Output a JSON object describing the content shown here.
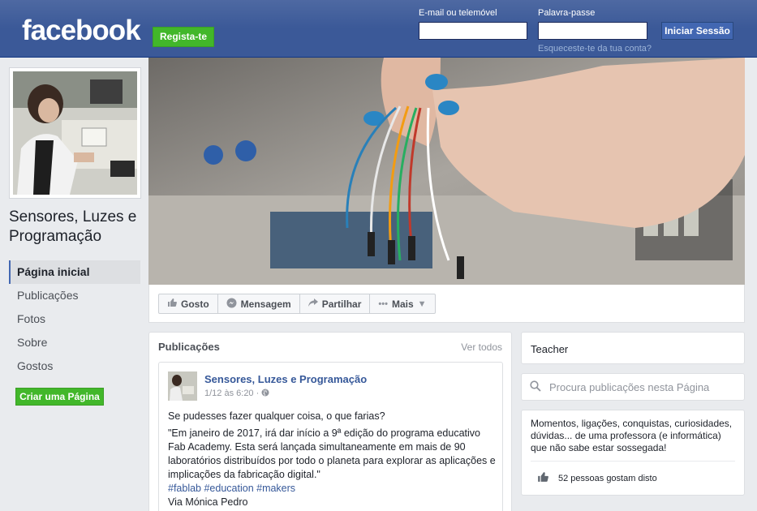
{
  "header": {
    "logo": "facebook",
    "signup_label": "Regista-te",
    "email_label": "E-mail ou telemóvel",
    "email_value": "",
    "password_label": "Palavra-passe",
    "password_value": "",
    "login_label": "Iniciar Sessão",
    "forgot_label": "Esqueceste-te da tua conta?"
  },
  "sidebar": {
    "page_name": "Sensores, Luzes e Programação",
    "items": [
      {
        "label": "Página inicial",
        "active": true
      },
      {
        "label": "Publicações",
        "active": false
      },
      {
        "label": "Fotos",
        "active": false
      },
      {
        "label": "Sobre",
        "active": false
      },
      {
        "label": "Gostos",
        "active": false
      }
    ],
    "create_page_label": "Criar uma Página"
  },
  "actions": [
    {
      "label": "Gosto",
      "icon": "thumbs-up-icon"
    },
    {
      "label": "Mensagem",
      "icon": "message-icon"
    },
    {
      "label": "Partilhar",
      "icon": "share-icon"
    },
    {
      "label": "Mais",
      "icon": "more-icon"
    }
  ],
  "posts": {
    "title": "Publicações",
    "see_all": "Ver todos",
    "post": {
      "author": "Sensores, Luzes e Programação",
      "time": "1/12 às 6:20 ·",
      "question": "Se pudesses fazer qualquer coisa, o que farias?",
      "quote": "\"Em janeiro de 2017, irá dar início a 9ª edição do programa educativo Fab Academy. Esta será lançada simultaneamente em mais de 90 laboratórios distribuídos por todo o planeta para explorar as aplicações e implicações da fabricação digital.\"",
      "hashtags": "#fablab #education #makers",
      "via": "Via Mónica Pedro"
    }
  },
  "right": {
    "category": "Teacher",
    "search_placeholder": "Procura publicações nesta Página",
    "about": "Momentos, ligações, conquistas, curiosidades, dúvidas... de uma professora (e informática) que não sabe estar sossegada!",
    "likes": "52 pessoas gostam disto"
  },
  "colors": {
    "brand": "#3b5998",
    "green": "#42b72a",
    "link": "#365899"
  }
}
